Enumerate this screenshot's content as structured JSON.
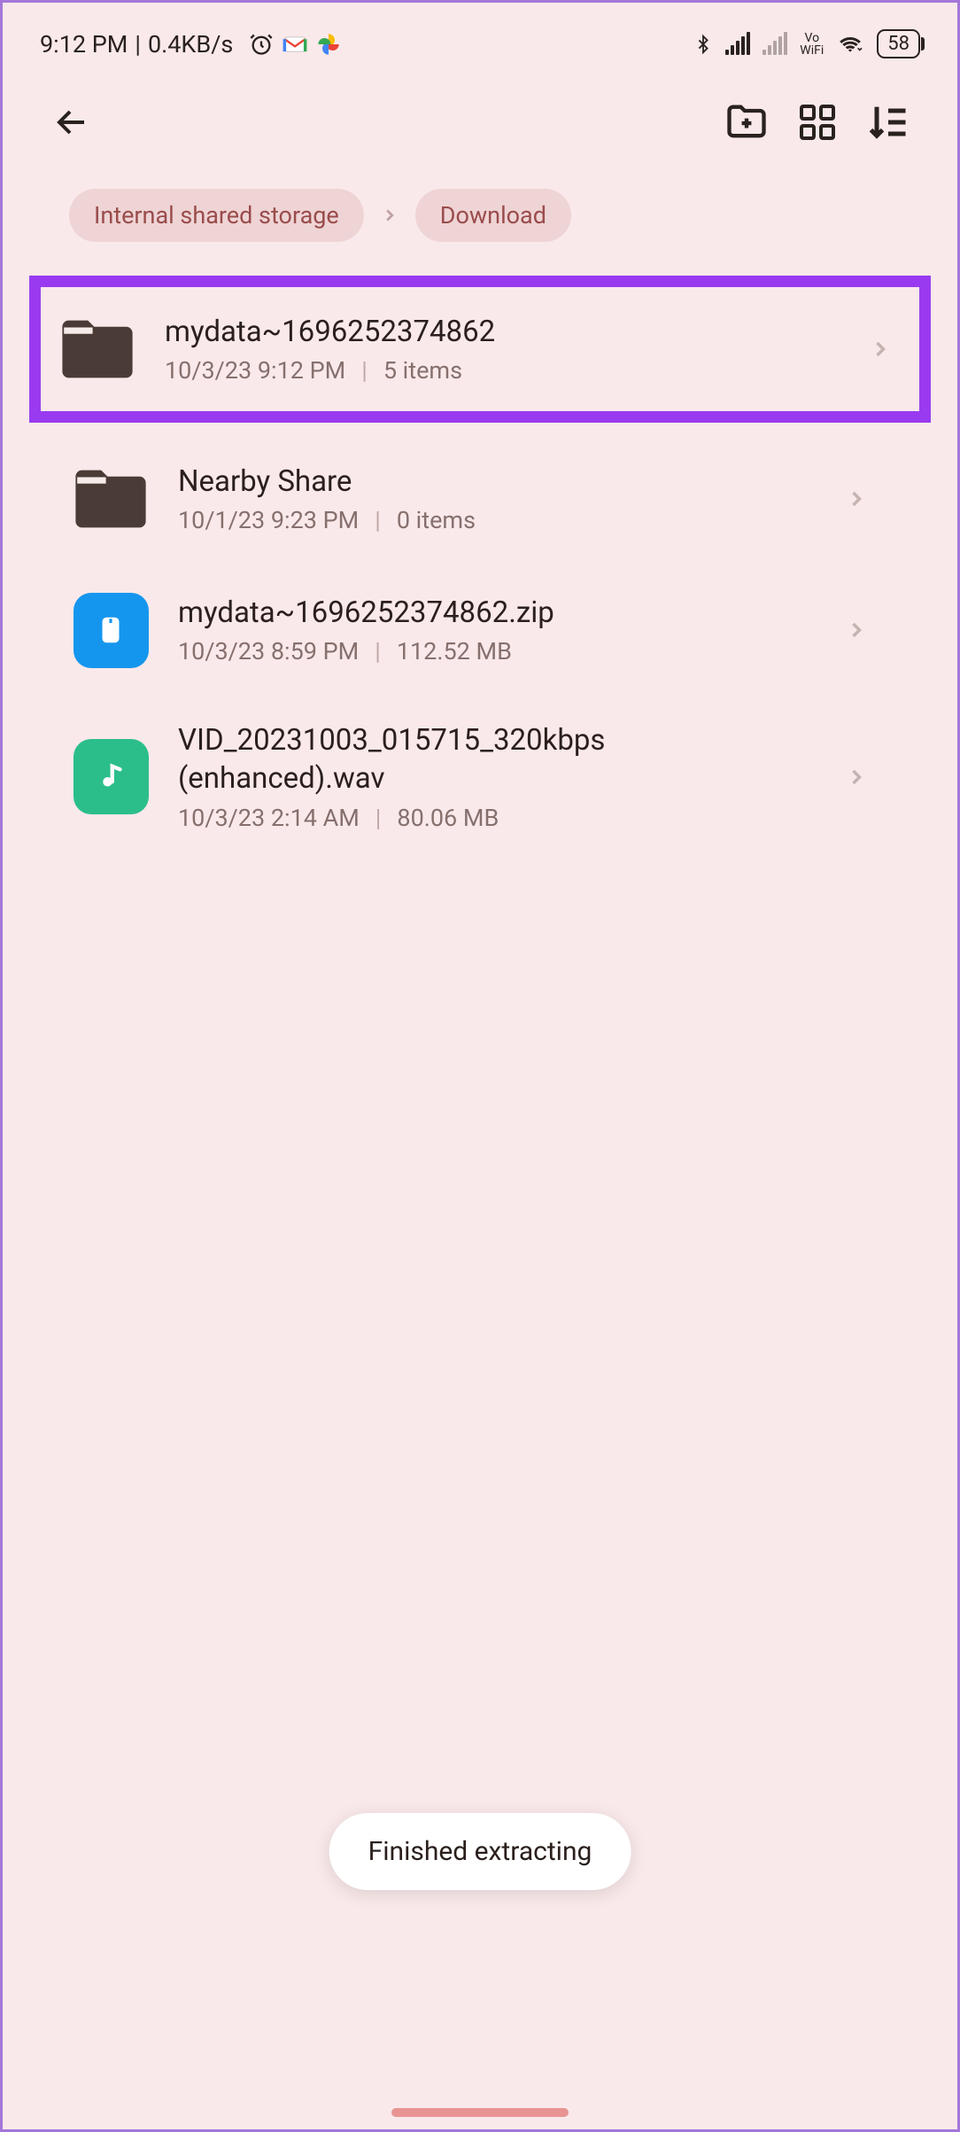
{
  "status_bar": {
    "time": "9:12 PM",
    "speed": "0.4KB/s",
    "vowifi_top": "Vo",
    "vowifi_bottom": "WiFi",
    "battery": "58"
  },
  "breadcrumb": {
    "items": [
      "Internal shared storage",
      "Download"
    ]
  },
  "files": [
    {
      "type": "folder",
      "name": "mydata~1696252374862",
      "date": "10/3/23 9:12 PM",
      "meta": "5 items",
      "highlighted": true
    },
    {
      "type": "folder",
      "name": "Nearby Share",
      "date": "10/1/23 9:23 PM",
      "meta": "0 items",
      "highlighted": false
    },
    {
      "type": "zip",
      "name": "mydata~1696252374862.zip",
      "date": "10/3/23 8:59 PM",
      "meta": "112.52 MB",
      "highlighted": false
    },
    {
      "type": "audio",
      "name": "VID_20231003_015715_320kbps (enhanced).wav",
      "date": "10/3/23 2:14 AM",
      "meta": "80.06 MB",
      "highlighted": false
    }
  ],
  "toast": "Finished extracting"
}
